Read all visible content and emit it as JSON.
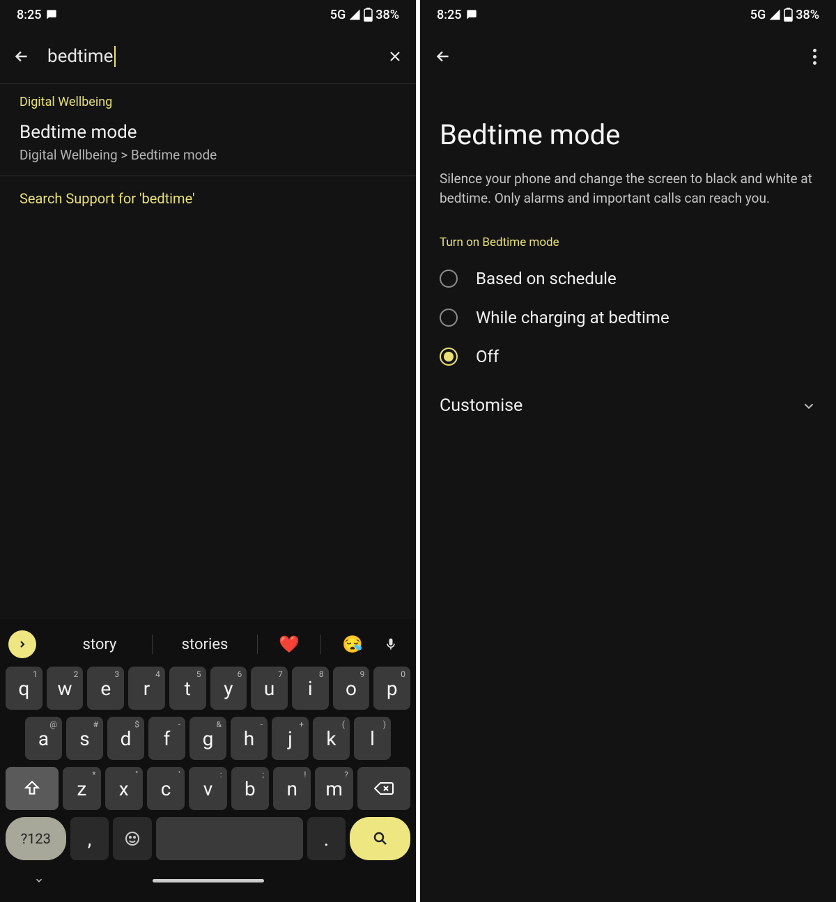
{
  "status": {
    "time": "8:25",
    "network": "5G",
    "battery": "38%"
  },
  "left": {
    "search_value": "bedtime",
    "section_label": "Digital Wellbeing",
    "result_title": "Bedtime mode",
    "result_path": "Digital Wellbeing > Bedtime mode",
    "support_link": "Search Support for 'bedtime'",
    "suggestions": [
      "story",
      "stories"
    ],
    "emoji1": "❤️",
    "emoji2": "😪",
    "keyboard": {
      "row1": [
        {
          "k": "q",
          "s": "1"
        },
        {
          "k": "w",
          "s": "2"
        },
        {
          "k": "e",
          "s": "3"
        },
        {
          "k": "r",
          "s": "4"
        },
        {
          "k": "t",
          "s": "5"
        },
        {
          "k": "y",
          "s": "6"
        },
        {
          "k": "u",
          "s": "7"
        },
        {
          "k": "i",
          "s": "8"
        },
        {
          "k": "o",
          "s": "9"
        },
        {
          "k": "p",
          "s": "0"
        }
      ],
      "row2": [
        {
          "k": "a",
          "s": "@"
        },
        {
          "k": "s",
          "s": "#"
        },
        {
          "k": "d",
          "s": "$"
        },
        {
          "k": "f",
          "s": "-"
        },
        {
          "k": "g",
          "s": "&"
        },
        {
          "k": "h",
          "s": "-"
        },
        {
          "k": "j",
          "s": "+"
        },
        {
          "k": "k",
          "s": "("
        },
        {
          "k": "l",
          "s": ")"
        }
      ],
      "row3": [
        {
          "k": "z",
          "s": "*"
        },
        {
          "k": "x",
          "s": "\""
        },
        {
          "k": "c",
          "s": "'"
        },
        {
          "k": "v",
          "s": ":"
        },
        {
          "k": "b",
          "s": ";"
        },
        {
          "k": "n",
          "s": "!"
        },
        {
          "k": "m",
          "s": "?"
        }
      ],
      "numswitch": "?123",
      "comma": ",",
      "period": "."
    }
  },
  "right": {
    "title": "Bedtime mode",
    "description": "Silence your phone and change the screen to black and white at bedtime. Only alarms and important calls can reach you.",
    "section_label": "Turn on Bedtime mode",
    "options": [
      {
        "label": "Based on schedule",
        "selected": false
      },
      {
        "label": "While charging at bedtime",
        "selected": false
      },
      {
        "label": "Off",
        "selected": true
      }
    ],
    "customise": "Customise"
  }
}
